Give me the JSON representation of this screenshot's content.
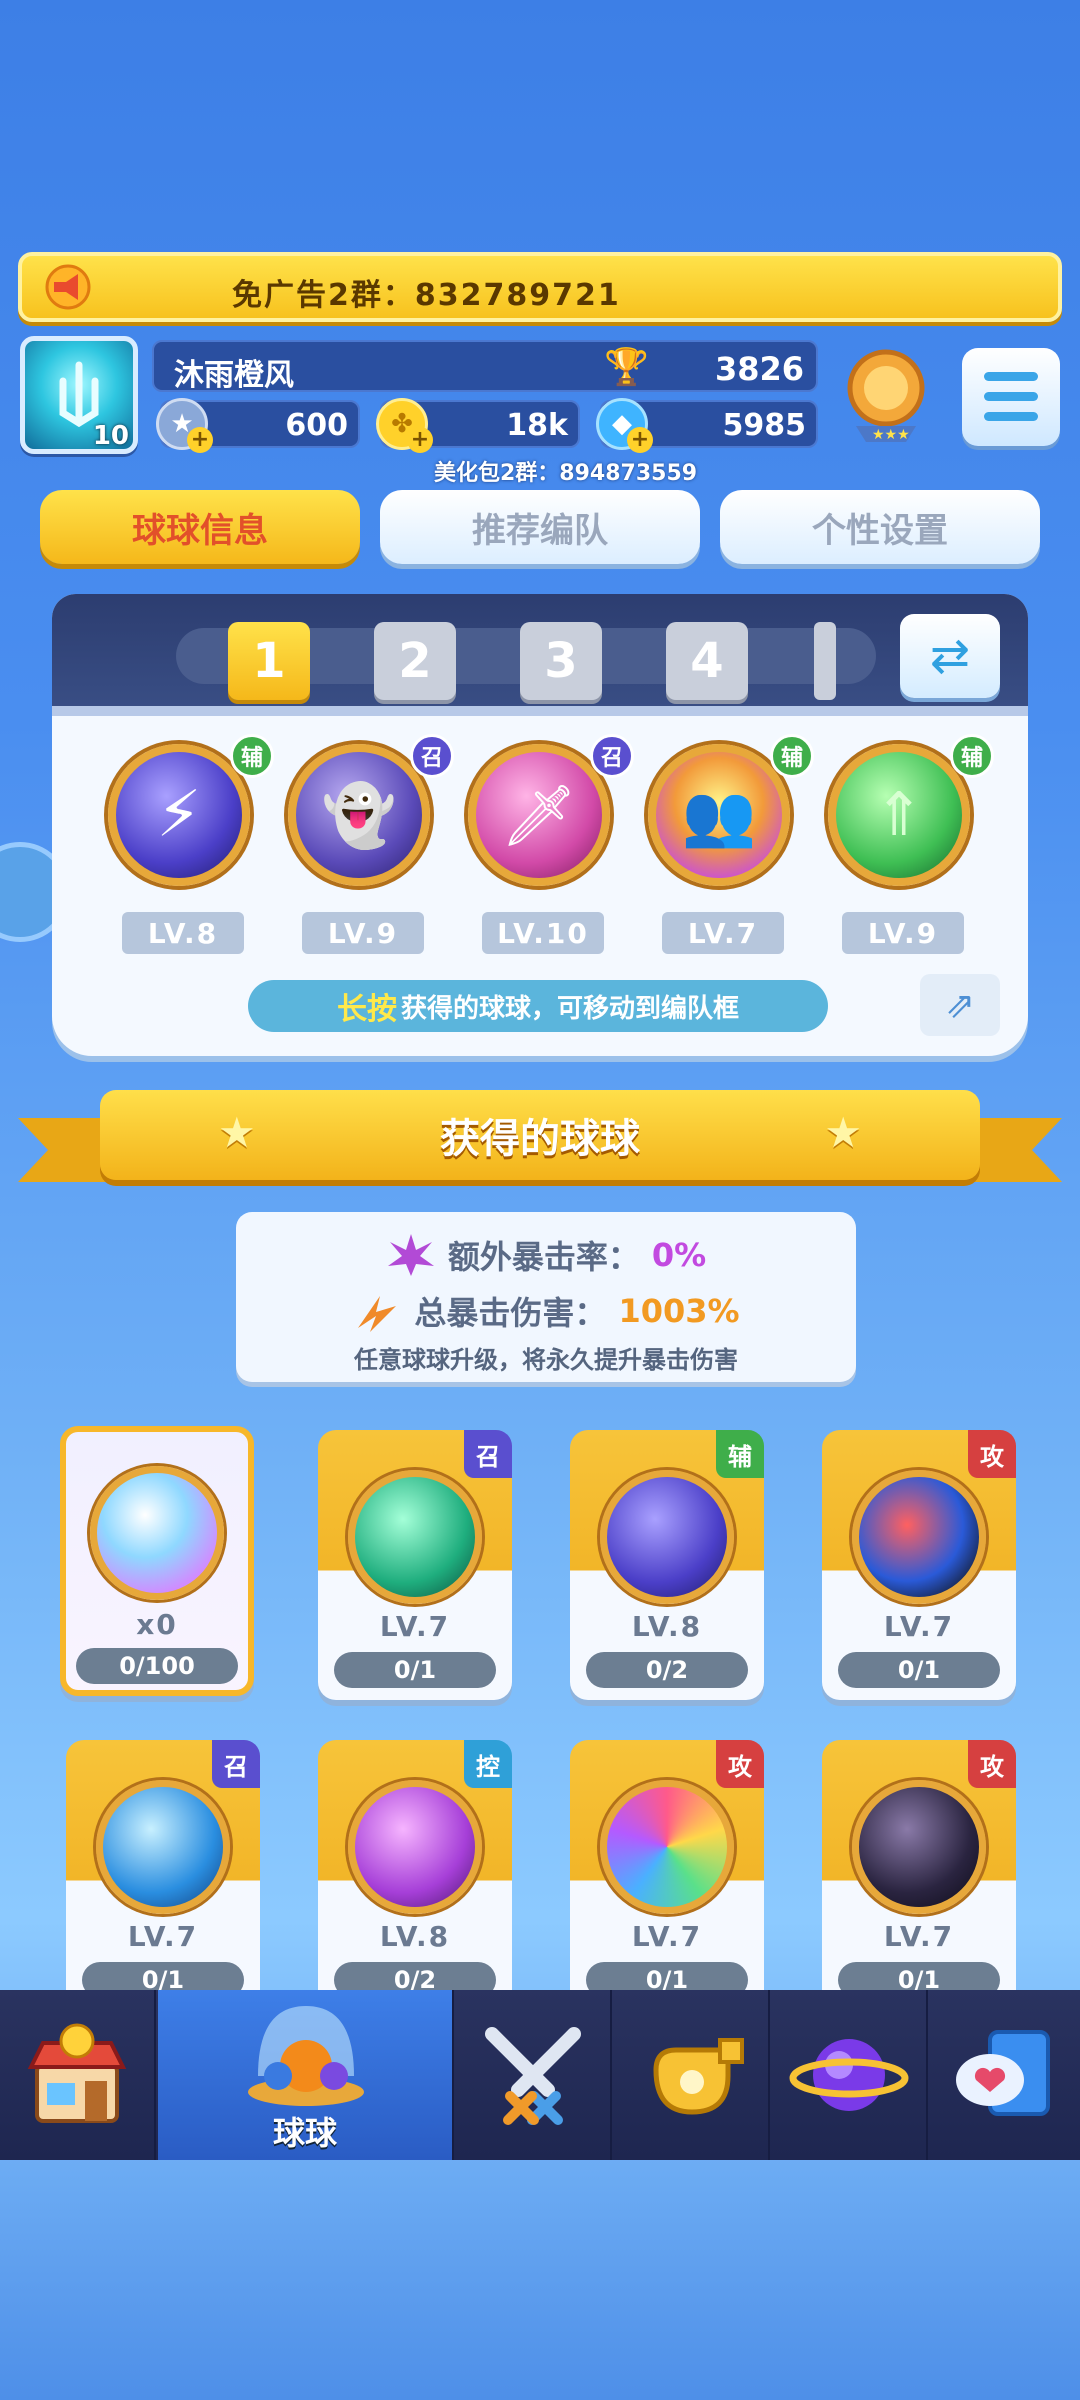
{
  "banner": {
    "text": "免广告2群：832789721"
  },
  "profile": {
    "name": "沐雨橙风",
    "avatar_level": "10",
    "trophies": "3826",
    "silver": "600",
    "gold": "18k",
    "gems": "5985",
    "sub_group": "美化包2群：894873559"
  },
  "tabs": [
    "球球信息",
    "推荐编队",
    "个性设置"
  ],
  "team": {
    "slots": [
      "1",
      "2",
      "3",
      "4"
    ],
    "active_slot": "1",
    "balls": [
      {
        "role": "辅",
        "level": "LV.8"
      },
      {
        "role": "召",
        "level": "LV.9"
      },
      {
        "role": "召",
        "level": "LV.10"
      },
      {
        "role": "辅",
        "level": "LV.7"
      },
      {
        "role": "辅",
        "level": "LV.9"
      }
    ],
    "hint_strong": "长按",
    "hint_rest": "获得的球球，可移动到编队框"
  },
  "section_title": "获得的球球",
  "crit": {
    "extra_rate_label": "额外暴击率：",
    "extra_rate_value": "0%",
    "total_dmg_label": "总暴击伤害：",
    "total_dmg_value": "1003%",
    "note": "任意球球升级，将永久提升暴击伤害"
  },
  "cards": [
    {
      "role": "",
      "level": "x0",
      "progress": "0/100",
      "special": true
    },
    {
      "role": "召",
      "level": "LV.7",
      "progress": "0/1"
    },
    {
      "role": "辅",
      "level": "LV.8",
      "progress": "0/2"
    },
    {
      "role": "攻",
      "level": "LV.7",
      "progress": "0/1"
    },
    {
      "role": "召",
      "level": "LV.7",
      "progress": "0/1"
    },
    {
      "role": "控",
      "level": "LV.8",
      "progress": "0/2"
    },
    {
      "role": "攻",
      "level": "LV.7",
      "progress": "0/1"
    },
    {
      "role": "攻",
      "level": "LV.7",
      "progress": "0/1"
    }
  ],
  "nav": {
    "items": [
      "shop-icon",
      "ball-icon",
      "battle-icon",
      "whistle-icon",
      "planet-icon",
      "chat-icon"
    ],
    "active_label": "球球"
  },
  "colors": {
    "accent_yellow": "#f5b81a",
    "role_fu": "#3fae4a",
    "role_zhao": "#5a4fcf",
    "role_gong": "#d64040",
    "role_kong": "#2fa0d8"
  }
}
